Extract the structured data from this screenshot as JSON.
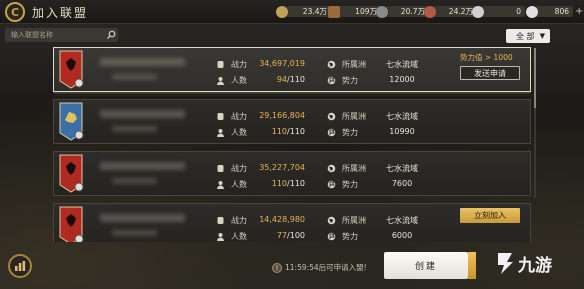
{
  "header": {
    "title": "加入联盟",
    "back_glyph": "C"
  },
  "resources": [
    {
      "name": "grain",
      "value": "23.4万",
      "color": "#c2a05a"
    },
    {
      "name": "wood",
      "value": "109万",
      "color": "#9a6a3a"
    },
    {
      "name": "stone",
      "value": "20.7万",
      "color": "#8a8a88"
    },
    {
      "name": "iron",
      "value": "24.2万",
      "color": "#b55a4a"
    },
    {
      "name": "copper",
      "value": "0",
      "color": "#d0d0d0"
    },
    {
      "name": "gold",
      "value": "806",
      "color": "#e0e0e0"
    }
  ],
  "search": {
    "placeholder": "输入联盟名称"
  },
  "filter": {
    "selected": "全 部"
  },
  "alliances": [
    {
      "banner_color": "#b02a22",
      "power_label": "战力",
      "power": "34,697,019",
      "members_label": "人数",
      "members_current": "94",
      "members_max": "/110",
      "region_label": "所属洲",
      "region": "七水流域",
      "force_label": "势力",
      "force": "12000",
      "requirement": "势力值 > 1000",
      "action": "发送申请",
      "selected": true
    },
    {
      "banner_color": "#3a6fa8",
      "power_label": "战力",
      "power": "29,166,804",
      "members_label": "人数",
      "members_current": "110",
      "members_max": "/110",
      "region_label": "所属洲",
      "region": "七水流域",
      "force_label": "势力",
      "force": "10990",
      "requirement": "",
      "action": "",
      "selected": false
    },
    {
      "banner_color": "#b02a22",
      "power_label": "战力",
      "power": "35,227,704",
      "members_label": "人数",
      "members_current": "110",
      "members_max": "/110",
      "region_label": "所属洲",
      "region": "七水流域",
      "force_label": "势力",
      "force": "7600",
      "requirement": "",
      "action": "",
      "selected": false
    },
    {
      "banner_color": "#b02a22",
      "power_label": "战力",
      "power": "14,428,980",
      "members_label": "人数",
      "members_current": "77",
      "members_max": "/100",
      "region_label": "所属洲",
      "region": "七水流域",
      "force_label": "势力",
      "force": "6000",
      "requirement": "",
      "action": "立刻加入",
      "selected": false
    }
  ],
  "footer": {
    "cooldown": "11:59:54后可申请入盟!",
    "warn_glyph": "!",
    "create": "创建"
  },
  "watermark": {
    "text": "九游"
  }
}
